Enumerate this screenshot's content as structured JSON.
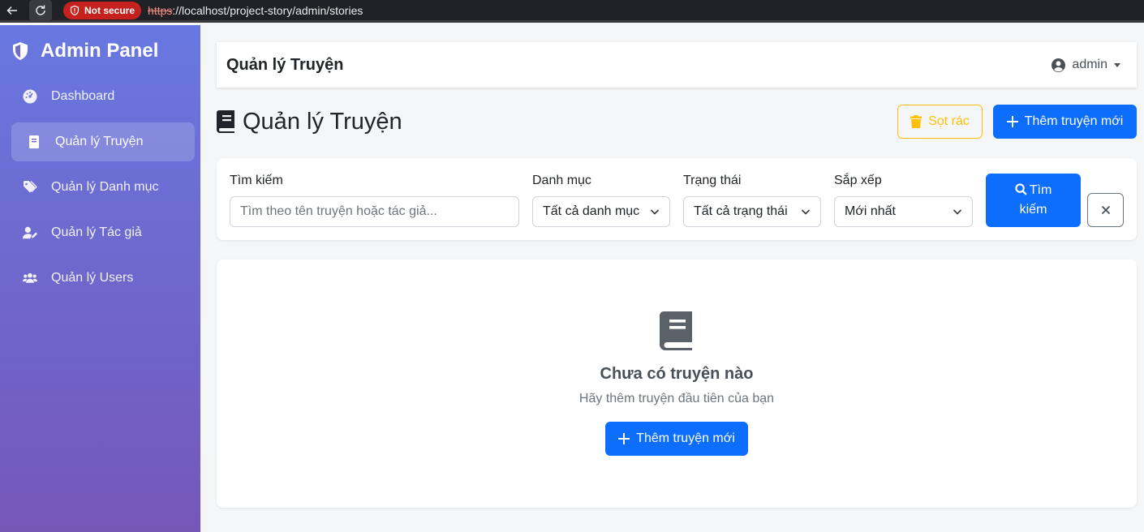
{
  "browser": {
    "security_label": "Not secure",
    "url_scheme": "https",
    "url_rest": "://localhost/project-story/admin/stories"
  },
  "sidebar": {
    "brand": "Admin Panel",
    "items": [
      {
        "label": "Dashboard",
        "icon": "gauge-icon",
        "active": false
      },
      {
        "label": "Quản lý Truyện",
        "icon": "book-icon",
        "active": true
      },
      {
        "label": "Quản lý Danh mục",
        "icon": "tags-icon",
        "active": false
      },
      {
        "label": "Quản lý Tác giả",
        "icon": "user-edit-icon",
        "active": false
      },
      {
        "label": "Quản lý Users",
        "icon": "users-icon",
        "active": false
      }
    ]
  },
  "header": {
    "title": "Quản lý Truyện",
    "user": "admin"
  },
  "page": {
    "title": "Quản lý Truyện",
    "trash_label": "Sọt rác",
    "add_label": "Thêm truyện mới"
  },
  "filters": {
    "search_label": "Tìm kiếm",
    "search_placeholder": "Tìm theo tên truyện hoặc tác giả...",
    "category_label": "Danh mục",
    "category_value": "Tất cả danh mục",
    "status_label": "Trạng thái",
    "status_value": "Tất cả trạng thái",
    "sort_label": "Sắp xếp",
    "sort_value": "Mới nhất",
    "search_button_line1": "Tìm",
    "search_button_line2": "kiếm"
  },
  "empty": {
    "title": "Chưa có truyện nào",
    "subtitle": "Hãy thêm truyện đầu tiên của bạn",
    "add_label": "Thêm truyện mới"
  },
  "colors": {
    "primary": "#0d6efd",
    "warning": "#ffc107",
    "sidebar_top": "#6878e0",
    "sidebar_bottom": "#7557b8",
    "insecure": "#c5221f"
  }
}
